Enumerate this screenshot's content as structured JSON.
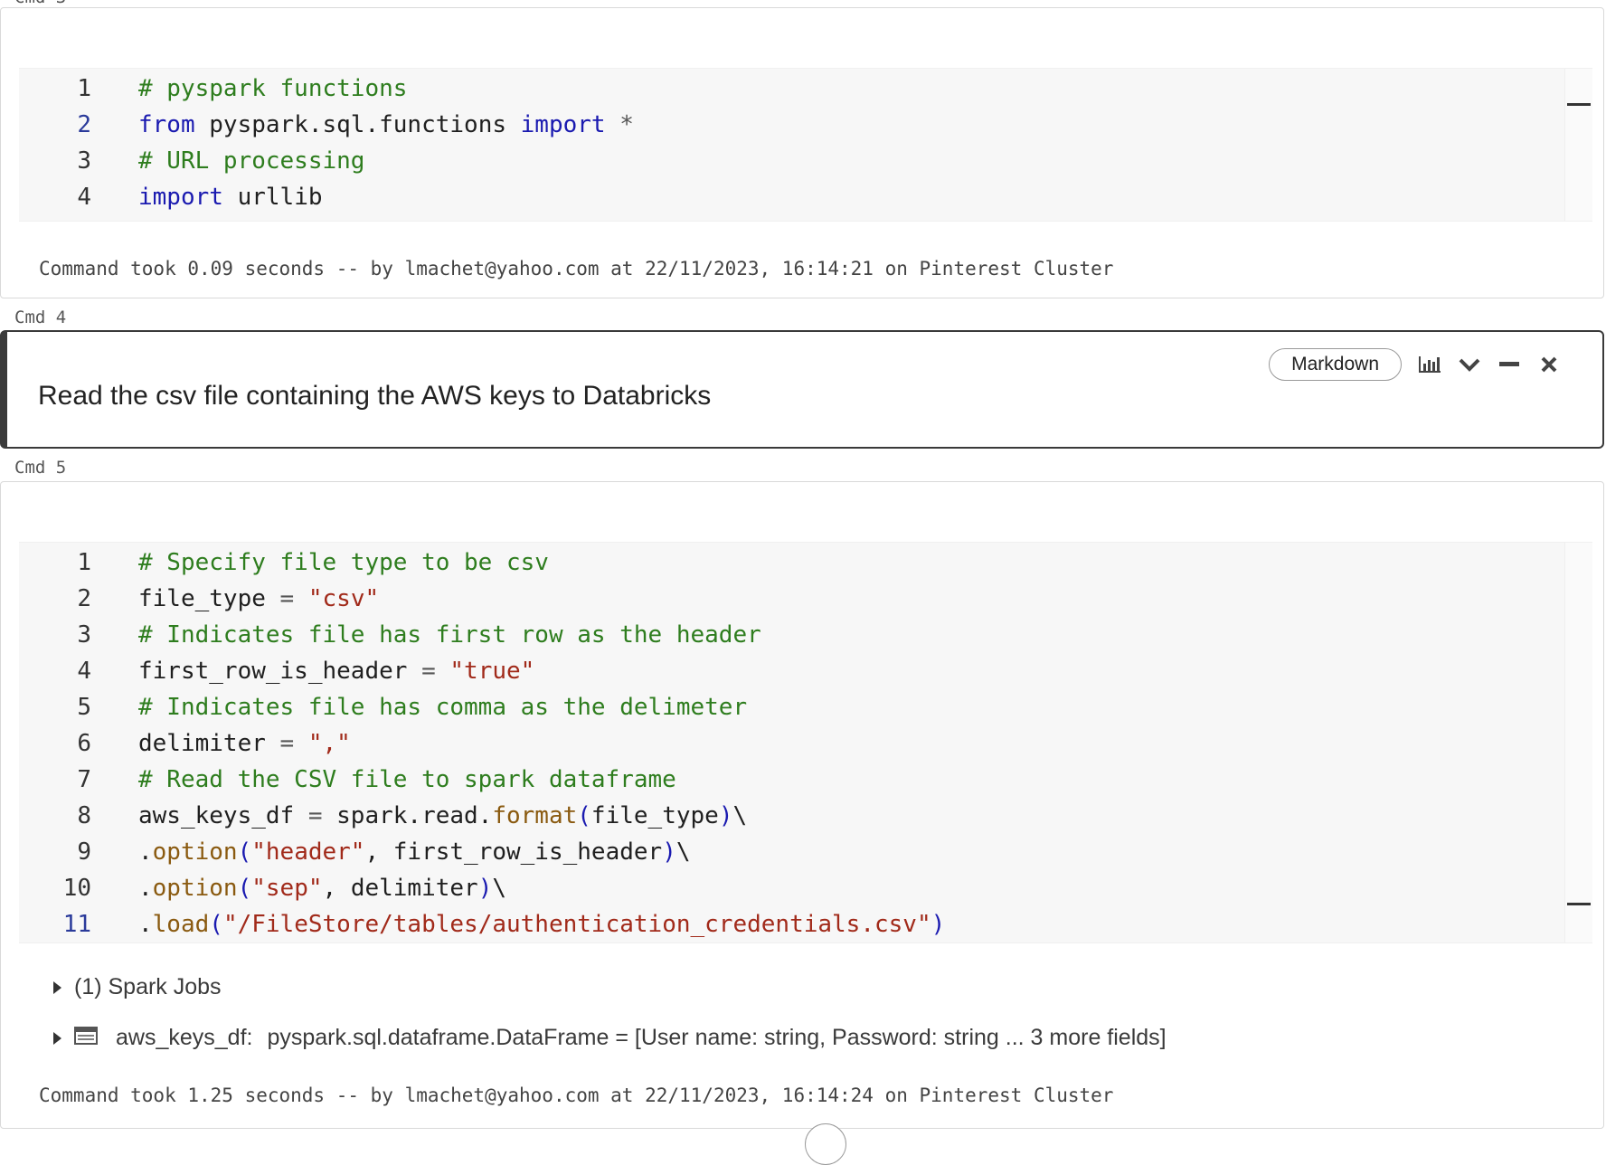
{
  "top_partial_label": "Cmd 3",
  "cell3": {
    "lines": [
      {
        "num": "1",
        "tokens": [
          {
            "t": "# pyspark functions",
            "c": "c"
          }
        ]
      },
      {
        "num": "2",
        "tokens": [
          {
            "t": "from",
            "c": "k"
          },
          {
            "t": " pyspark.sql.functions ",
            "c": ""
          },
          {
            "t": "import",
            "c": "k"
          },
          {
            "t": " *",
            "c": "o"
          }
        ]
      },
      {
        "num": "3",
        "tokens": [
          {
            "t": "# URL processing",
            "c": "c"
          }
        ]
      },
      {
        "num": "4",
        "tokens": [
          {
            "t": "import",
            "c": "k"
          },
          {
            "t": " urllib",
            "c": ""
          }
        ]
      }
    ],
    "status": "Command took 0.09 seconds -- by lmachet@yahoo.com at 22/11/2023, 16:14:21 on Pinterest Cluster"
  },
  "cmd4_label": "Cmd 4",
  "cell4": {
    "text": "Read the csv file containing the AWS keys to Databricks",
    "badge": "Markdown"
  },
  "cmd5_label": "Cmd 5",
  "cell5": {
    "lines": [
      {
        "num": "1",
        "tokens": [
          {
            "t": "# Specify file type to be csv",
            "c": "c"
          }
        ]
      },
      {
        "num": "2",
        "tokens": [
          {
            "t": "file_type ",
            "c": ""
          },
          {
            "t": "=",
            "c": "o"
          },
          {
            "t": " ",
            "c": ""
          },
          {
            "t": "\"csv\"",
            "c": "s"
          }
        ]
      },
      {
        "num": "3",
        "tokens": [
          {
            "t": "# Indicates file has first row as the header",
            "c": "c"
          }
        ]
      },
      {
        "num": "4",
        "tokens": [
          {
            "t": "first_row_is_header ",
            "c": ""
          },
          {
            "t": "=",
            "c": "o"
          },
          {
            "t": " ",
            "c": ""
          },
          {
            "t": "\"true\"",
            "c": "s"
          }
        ]
      },
      {
        "num": "5",
        "tokens": [
          {
            "t": "# Indicates file has comma as the delimeter",
            "c": "c"
          }
        ]
      },
      {
        "num": "6",
        "tokens": [
          {
            "t": "delimiter ",
            "c": ""
          },
          {
            "t": "=",
            "c": "o"
          },
          {
            "t": " ",
            "c": ""
          },
          {
            "t": "\",\"",
            "c": "s"
          }
        ]
      },
      {
        "num": "7",
        "tokens": [
          {
            "t": "# Read the CSV file to spark dataframe",
            "c": "c"
          }
        ]
      },
      {
        "num": "8",
        "tokens": [
          {
            "t": "aws_keys_df ",
            "c": ""
          },
          {
            "t": "=",
            "c": "o"
          },
          {
            "t": " spark.read.",
            "c": ""
          },
          {
            "t": "format",
            "c": "f"
          },
          {
            "t": "(",
            "c": "p"
          },
          {
            "t": "file_type",
            "c": ""
          },
          {
            "t": ")",
            "c": "p"
          },
          {
            "t": "\\",
            "c": ""
          }
        ]
      },
      {
        "num": "9",
        "tokens": [
          {
            "t": ".",
            "c": ""
          },
          {
            "t": "option",
            "c": "f"
          },
          {
            "t": "(",
            "c": "p"
          },
          {
            "t": "\"header\"",
            "c": "s"
          },
          {
            "t": ", first_row_is_header",
            "c": ""
          },
          {
            "t": ")",
            "c": "p"
          },
          {
            "t": "\\",
            "c": ""
          }
        ]
      },
      {
        "num": "10",
        "tokens": [
          {
            "t": ".",
            "c": ""
          },
          {
            "t": "option",
            "c": "f"
          },
          {
            "t": "(",
            "c": "p"
          },
          {
            "t": "\"sep\"",
            "c": "s"
          },
          {
            "t": ", delimiter",
            "c": ""
          },
          {
            "t": ")",
            "c": "p"
          },
          {
            "t": "\\",
            "c": ""
          }
        ]
      },
      {
        "num": "11",
        "tokens": [
          {
            "t": ".",
            "c": ""
          },
          {
            "t": "load",
            "c": "f"
          },
          {
            "t": "(",
            "c": "p"
          },
          {
            "t": "\"/FileStore/tables/authentication_credentials.csv\"",
            "c": "s"
          },
          {
            "t": ")",
            "c": "p"
          }
        ]
      }
    ],
    "spark_jobs": "(1) Spark Jobs",
    "df_name": "aws_keys_df:",
    "df_schema": "pyspark.sql.dataframe.DataFrame = [User name: string, Password: string ... 3 more fields]",
    "status": "Command took 1.25 seconds -- by lmachet@yahoo.com at 22/11/2023, 16:14:24 on Pinterest Cluster"
  }
}
